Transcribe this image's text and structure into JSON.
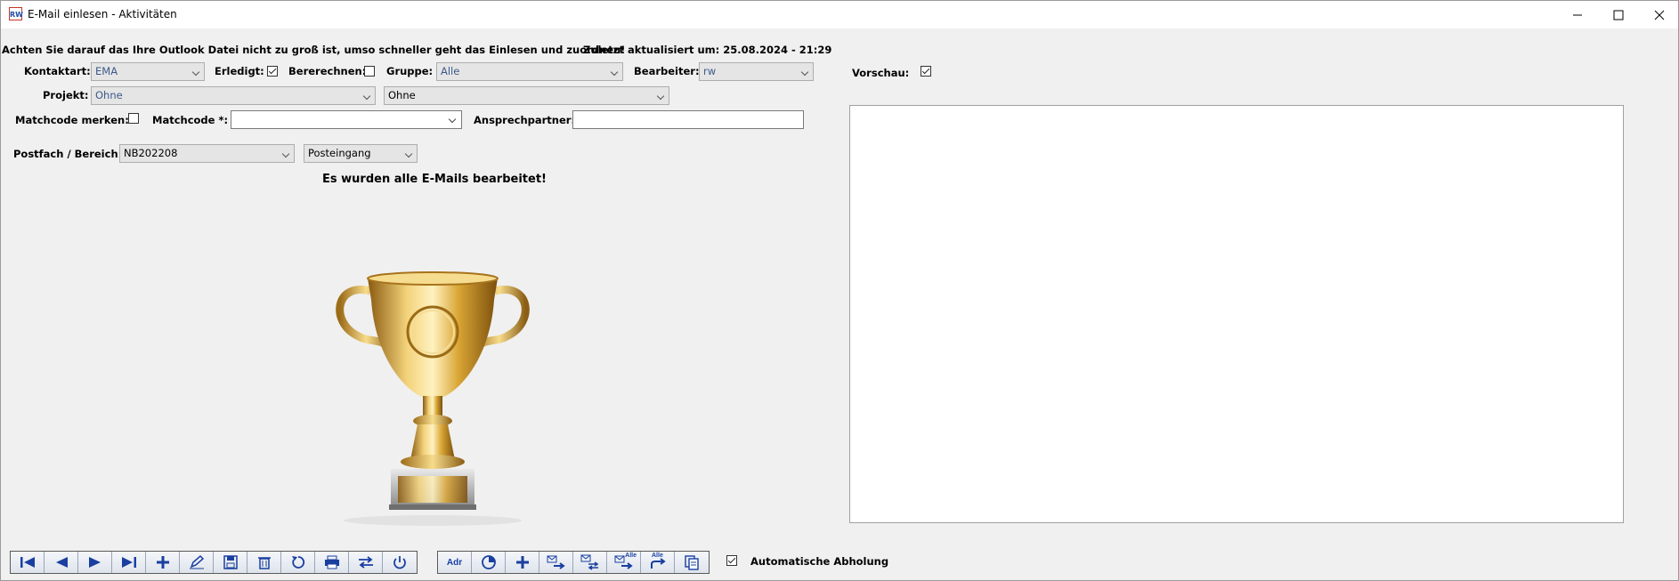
{
  "window": {
    "title": "E-Mail einlesen - Aktivitäten",
    "controls": [
      "minimize-icon",
      "maximize-icon",
      "close-icon"
    ]
  },
  "header": {
    "warning": "Achten Sie darauf das Ihre Outlook Datei nicht zu groß ist, umso schneller geht das Einlesen und zuordnen!",
    "updated": "Zuletzt aktualisiert um: 25.08.2024 - 21:29"
  },
  "form": {
    "kontaktart_label": "Kontaktart:",
    "kontaktart_value": "EMA",
    "erledigt_label": "Erledigt:",
    "erledigt_checked": true,
    "bererechnen_label": "Bererechnen:",
    "bererechnen_checked": false,
    "gruppe_label": "Gruppe:",
    "gruppe_value": "Alle",
    "bearbeiter_label": "Bearbeiter:",
    "bearbeiter_value": "rw",
    "projekt_label": "Projekt:",
    "projekt_value": "Ohne",
    "projekt2_value": "Ohne",
    "matchcode_merken_label": "Matchcode merken:",
    "matchcode_merken_checked": false,
    "matchcode_label": "Matchcode *:",
    "matchcode_value": "",
    "ansprechpartner_label": "Ansprechpartner:",
    "ansprechpartner_value": "",
    "postfach_label": "Postfach / Bereich:",
    "postfach_value": "NB202208",
    "bereich_value": "Posteingang"
  },
  "status": {
    "message": "Es wurden alle E-Mails bearbeitet!"
  },
  "preview": {
    "label": "Vorschau:",
    "checked": true
  },
  "toolbar": {
    "nav_buttons": [
      "first-icon",
      "previous-icon",
      "next-icon",
      "last-icon",
      "add-icon",
      "edit-icon",
      "save-icon",
      "delete-icon",
      "undo-icon",
      "print-icon",
      "swap-icon",
      "power-icon"
    ],
    "action_buttons": [
      {
        "icon": "address-icon",
        "text": "Adr"
      },
      {
        "icon": "chart-icon",
        "text": ""
      },
      {
        "icon": "add-icon",
        "text": ""
      },
      {
        "icon": "mail-forward-icon",
        "text": ""
      },
      {
        "icon": "mail-swap-icon",
        "text": ""
      },
      {
        "icon": "mail-forward-all-icon",
        "text": "Alle"
      },
      {
        "icon": "forward-all-icon",
        "text": "Alle"
      },
      {
        "icon": "copy-icon",
        "text": ""
      }
    ],
    "auto_label": "Automatische Abholung",
    "auto_checked": true
  },
  "colors": {
    "toolbar_icon": "#1a3fa0",
    "trophy_gold": "#d4a02a"
  }
}
